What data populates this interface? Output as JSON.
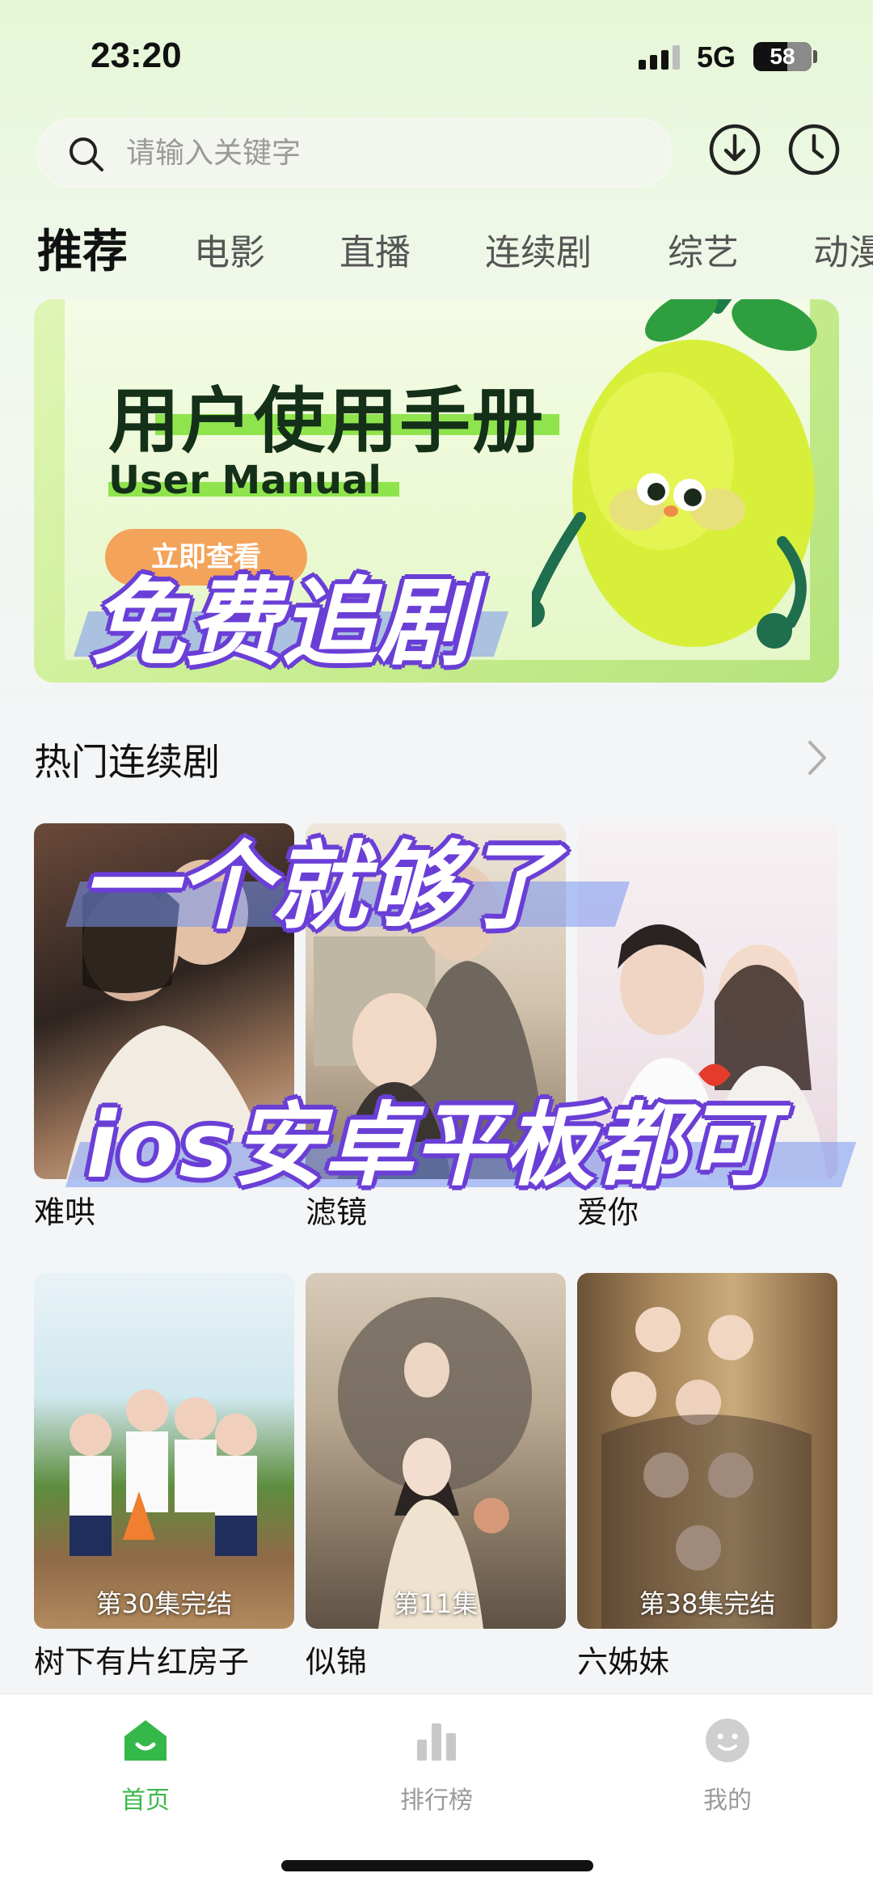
{
  "status_bar": {
    "time": "23:20",
    "network": "5G",
    "battery": "58",
    "battery_level": 0.58
  },
  "search": {
    "placeholder": "请输入关键字"
  },
  "top_icons": [
    "download-icon",
    "history-clock-icon"
  ],
  "tabs": [
    {
      "label": "推荐",
      "active": true
    },
    {
      "label": "电影"
    },
    {
      "label": "直播"
    },
    {
      "label": "连续剧"
    },
    {
      "label": "综艺"
    },
    {
      "label": "动漫"
    }
  ],
  "banner": {
    "title": "用户使用手册",
    "subtitle": "User Manual",
    "button": "立即查看"
  },
  "section": {
    "title": "热门连续剧"
  },
  "shows": [
    {
      "title": "难哄",
      "episode": ""
    },
    {
      "title": "滤镜",
      "episode": ""
    },
    {
      "title": "爱你",
      "episode": ""
    },
    {
      "title": "树下有片红房子",
      "episode": "第30集完结"
    },
    {
      "title": "似锦",
      "episode": "第11集"
    },
    {
      "title": "六姊妹",
      "episode": "第38集完结"
    }
  ],
  "overlay_text": {
    "line1": "免费追剧",
    "line2": "一个就够了",
    "line3": "ios安卓平板都可"
  },
  "bottom_nav": [
    {
      "label": "首页",
      "icon": "home-icon",
      "active": true
    },
    {
      "label": "排行榜",
      "icon": "bar-chart-icon"
    },
    {
      "label": "我的",
      "icon": "profile-face-icon"
    }
  ],
  "colors": {
    "accent": "#3cb84a",
    "overlay_outline": "#6a3fd6"
  }
}
